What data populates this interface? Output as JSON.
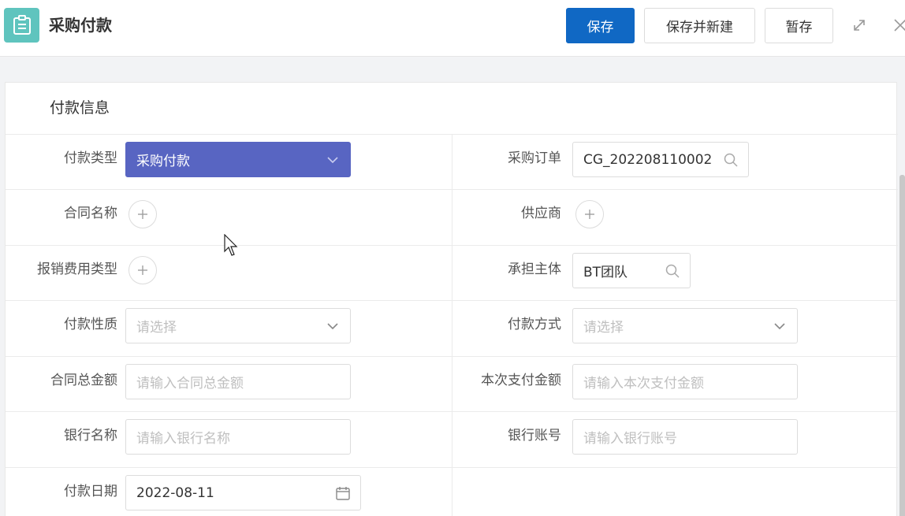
{
  "header": {
    "title": "采购付款",
    "save_label": "保存",
    "save_new_label": "保存并新建",
    "draft_label": "暂存",
    "icons": {
      "app": "clipboard-icon",
      "expand": "expand-icon",
      "close": "close-icon"
    }
  },
  "section": {
    "title": "付款信息"
  },
  "form": {
    "payment_type": {
      "label": "付款类型",
      "value": "采购付款"
    },
    "purchase_order": {
      "label": "采购订单",
      "value": "CG_202208110002"
    },
    "contract_name": {
      "label": "合同名称"
    },
    "supplier": {
      "label": "供应商"
    },
    "expense_type": {
      "label": "报销费用类型"
    },
    "responsible_entity": {
      "label": "承担主体",
      "value": "BT团队"
    },
    "payment_nature": {
      "label": "付款性质",
      "placeholder": "请选择"
    },
    "payment_method": {
      "label": "付款方式",
      "placeholder": "请选择"
    },
    "contract_total": {
      "label": "合同总金额",
      "placeholder": "请输入合同总金额"
    },
    "payment_amount": {
      "label": "本次支付金额",
      "placeholder": "请输入本次支付金额"
    },
    "bank_name": {
      "label": "银行名称",
      "placeholder": "请输入银行名称"
    },
    "bank_account": {
      "label": "银行账号",
      "placeholder": "请输入银行账号"
    },
    "payment_date": {
      "label": "付款日期",
      "value": "2022-08-11"
    }
  },
  "colors": {
    "primary": "#1068c4",
    "select_active": "#5865c2",
    "app_icon": "#5fc4be"
  }
}
